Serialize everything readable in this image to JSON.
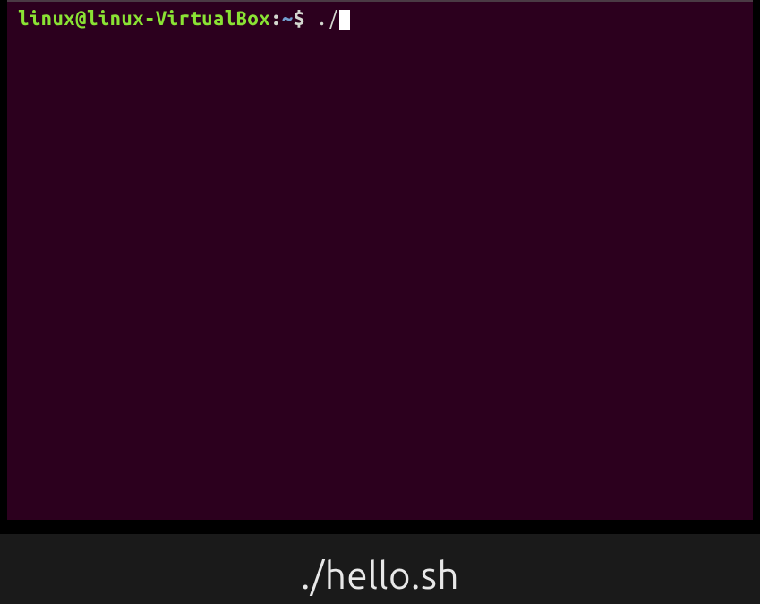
{
  "terminal": {
    "prompt": {
      "user": "linux",
      "at": "@",
      "host": "linux-VirtualBox",
      "separator": ":",
      "path": "~",
      "symbol": "$"
    },
    "command": "./"
  },
  "caption": {
    "text": "./hello.sh"
  }
}
